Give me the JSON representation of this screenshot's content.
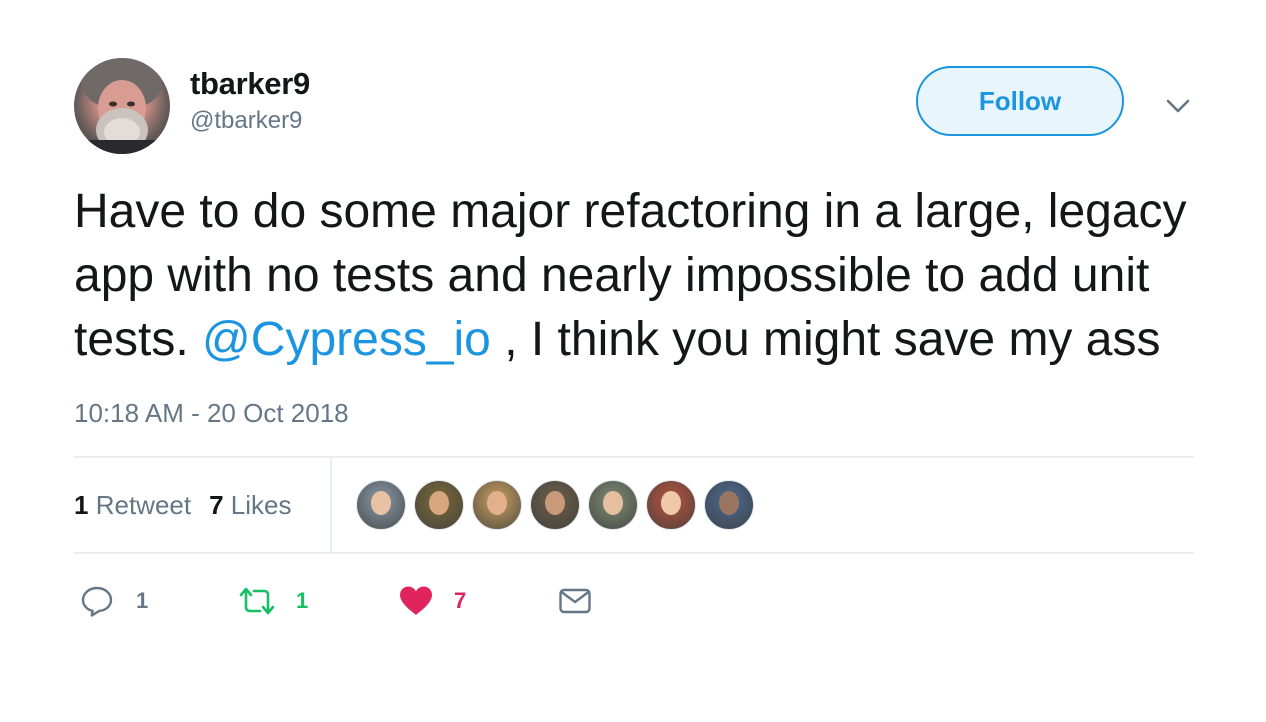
{
  "author": {
    "display_name": "tbarker9",
    "screen_name": "@tbarker9",
    "avatar_icon": "user-avatar"
  },
  "follow_button": {
    "label": "Follow"
  },
  "menu_caret_icon": "chevron-down-icon",
  "tweet": {
    "text_before_mention": "Have to do some major refactoring in a large, legacy app with no tests and nearly impossible to add unit tests. ",
    "mention": "@Cypress_io",
    "text_after_mention": " , I think you might save my ass",
    "timestamp": "10:18 AM - 20 Oct 2018"
  },
  "stats": {
    "retweet_count": "1",
    "retweet_label": "Retweet",
    "like_count": "7",
    "like_label": "Likes"
  },
  "likers": [
    {
      "icon": "liker-avatar",
      "color": "#8a9aa8"
    },
    {
      "icon": "liker-avatar",
      "color": "#7a6a3a"
    },
    {
      "icon": "liker-avatar",
      "color": "#c8a060"
    },
    {
      "icon": "liker-avatar",
      "color": "#6c5f4a"
    },
    {
      "icon": "liker-avatar",
      "color": "#7f8c74"
    },
    {
      "icon": "liker-avatar",
      "color": "#b7553f"
    },
    {
      "icon": "liker-avatar",
      "color": "#4c6a90"
    }
  ],
  "actions": {
    "reply": {
      "icon": "reply-icon",
      "count": "1",
      "color": "#657786"
    },
    "retweet": {
      "icon": "retweet-icon",
      "count": "1",
      "color": "#17bf63"
    },
    "like": {
      "icon": "heart-icon",
      "count": "7",
      "color": "#e0245e"
    },
    "message": {
      "icon": "envelope-icon",
      "color": "#657786"
    }
  },
  "colors": {
    "accent": "#1b95e0",
    "secondary_text": "#657786",
    "divider": "#e6ecf0"
  }
}
